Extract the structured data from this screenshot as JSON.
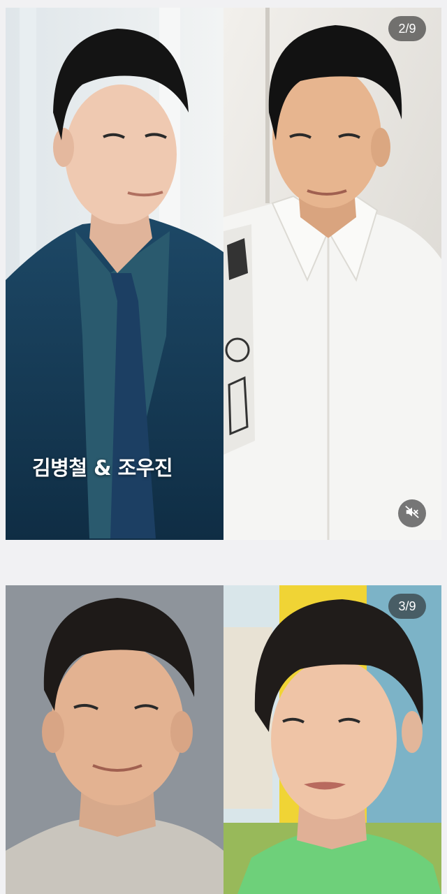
{
  "cards": [
    {
      "counter": "2/9",
      "caption": "김병철 & 조우진",
      "mute_icon": "speaker-muted-icon"
    },
    {
      "counter": "3/9"
    }
  ],
  "colors": {
    "background": "#f1f1f3",
    "badge_bg": "rgba(40,40,40,0.62)",
    "badge_text": "#ffffff"
  }
}
